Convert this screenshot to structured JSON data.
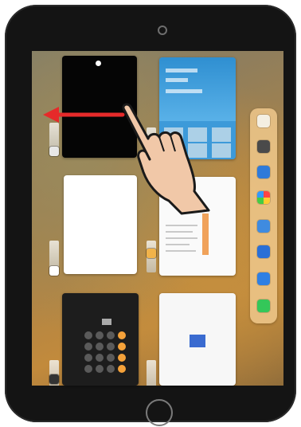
{
  "device": {
    "colors": {
      "bezel": "#141414",
      "arrow": "#e62a2a",
      "hand_fill": "#f1c8a8",
      "hand_stroke": "#1a1a1a"
    }
  },
  "app_switcher": {
    "cards": [
      {
        "id": "black-app",
        "icon": "dark-app-icon"
      },
      {
        "id": "weather-app",
        "icon": "weather-icon"
      },
      {
        "id": "blank-app",
        "icon": "app-icon"
      },
      {
        "id": "list-app",
        "icon": "notes-icon"
      },
      {
        "id": "calculator-app",
        "icon": "calculator-icon"
      },
      {
        "id": "document-app",
        "icon": "document-icon"
      }
    ]
  },
  "dock": {
    "icons": [
      "folder-icon",
      "settings-icon",
      "files-icon",
      "photos-icon",
      "pages-icon",
      "notes-icon",
      "safari-icon",
      "messages-icon"
    ]
  },
  "gesture": {
    "direction": "swipe-left",
    "icon": "hand-pointer-icon"
  }
}
